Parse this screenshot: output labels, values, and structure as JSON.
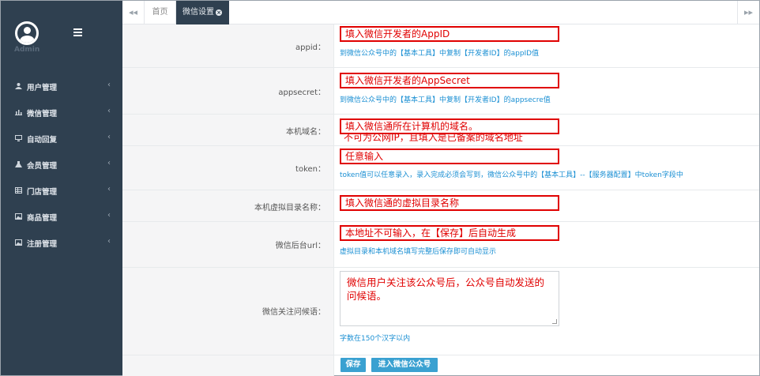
{
  "sidebar": {
    "user_name": "Admin",
    "items": [
      {
        "label": "用户管理",
        "icon": "user-icon",
        "arrow": "‹"
      },
      {
        "label": "微信管理",
        "icon": "bar-chart-icon",
        "arrow": "‹"
      },
      {
        "label": "自动回复",
        "icon": "monitor-icon",
        "arrow": "‹"
      },
      {
        "label": "会员管理",
        "icon": "flask-icon",
        "arrow": "‹"
      },
      {
        "label": "门店管理",
        "icon": "table-icon",
        "arrow": "‹"
      },
      {
        "label": "商品管理",
        "icon": "picture-icon",
        "arrow": "‹"
      },
      {
        "label": "注册管理",
        "icon": "picture-icon",
        "arrow": "‹"
      }
    ]
  },
  "tabs": {
    "prev": "◂◂",
    "home": "首页",
    "active": "微信设置",
    "close": "×",
    "next": "▸▸"
  },
  "form": {
    "appid": {
      "label": "appid：",
      "value": "填入微信开发者的AppID",
      "help": "到微信公众号中的【基本工具】中复制【开发者ID】的appID值"
    },
    "appsecret": {
      "label": "appsecret：",
      "value": "填入微信开发者的AppSecret",
      "help": "到微信公众号中的【基本工具】中复制【开发者ID】的appsecre值"
    },
    "domain": {
      "label": "本机域名：",
      "value": "填入微信通所在计算机的域名。",
      "note": "不可为公网IP，且填入是已备案的域名地址"
    },
    "token": {
      "label": "token：",
      "value": "任意输入",
      "help": "token值可以任意录入，录入完成必须会写到，微信公众号中的【基本工具】--【服务器配置】中token字段中"
    },
    "vdir": {
      "label": "本机虚拟目录名称：",
      "value": "填入微信通的虚拟目录名称"
    },
    "backend_url": {
      "label": "微信后台url：",
      "value": "本地址不可输入，在【保存】后自动生成",
      "help": "虚拟目录和本机域名填写完整后保存即可自动显示"
    },
    "greeting": {
      "label": "微信关注问候语：",
      "value": "微信用户关注该公众号后，公众号自动发送的问候语。",
      "help": "字数在150个汉字以内"
    }
  },
  "buttons": {
    "save": "保存",
    "enter": "进入微信公众号"
  },
  "colors": {
    "sidebar_bg": "#2f4050",
    "accent_button": "#3aa1d1",
    "annotation_red": "#e00000",
    "help_text": "#1a8fd3"
  }
}
